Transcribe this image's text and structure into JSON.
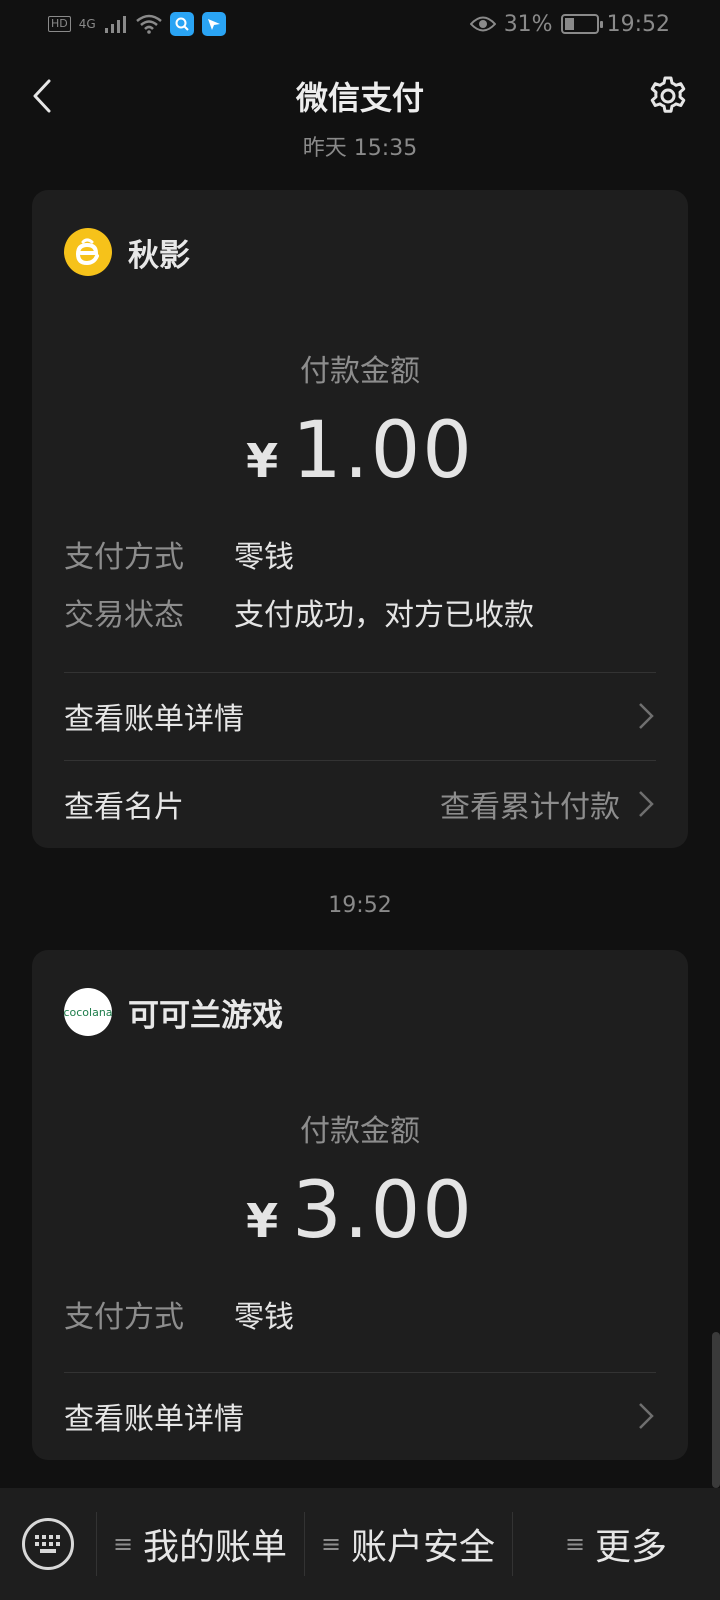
{
  "status_bar": {
    "hd": "HD",
    "network": "4G",
    "battery_percent": "31%",
    "battery_level": 0.31,
    "time": "19:52"
  },
  "nav": {
    "title": "微信支付"
  },
  "transactions": [
    {
      "time": "昨天 15:35",
      "merchant": "秋影",
      "amount_label": "付款金额",
      "currency": "¥",
      "amount": "1.00",
      "details": [
        {
          "key": "支付方式",
          "value": "零钱"
        },
        {
          "key": "交易状态",
          "value": "支付成功，对方已收款"
        }
      ],
      "links": [
        {
          "label": "查看账单详情",
          "right": ""
        },
        {
          "label": "查看名片",
          "right": "查看累计付款"
        }
      ]
    },
    {
      "time": "19:52",
      "merchant": "可可兰游戏",
      "avatar_text": "cocolana",
      "amount_label": "付款金额",
      "currency": "¥",
      "amount": "3.00",
      "details": [
        {
          "key": "支付方式",
          "value": "零钱"
        }
      ],
      "links": [
        {
          "label": "查看账单详情",
          "right": ""
        }
      ]
    }
  ],
  "bottom_menu": {
    "items": [
      {
        "label": "我的账单"
      },
      {
        "label": "账户安全"
      },
      {
        "label": "更多"
      }
    ]
  },
  "icons": {
    "back": "chevron-left-icon",
    "settings": "gear-icon",
    "keyboard": "keyboard-icon"
  }
}
